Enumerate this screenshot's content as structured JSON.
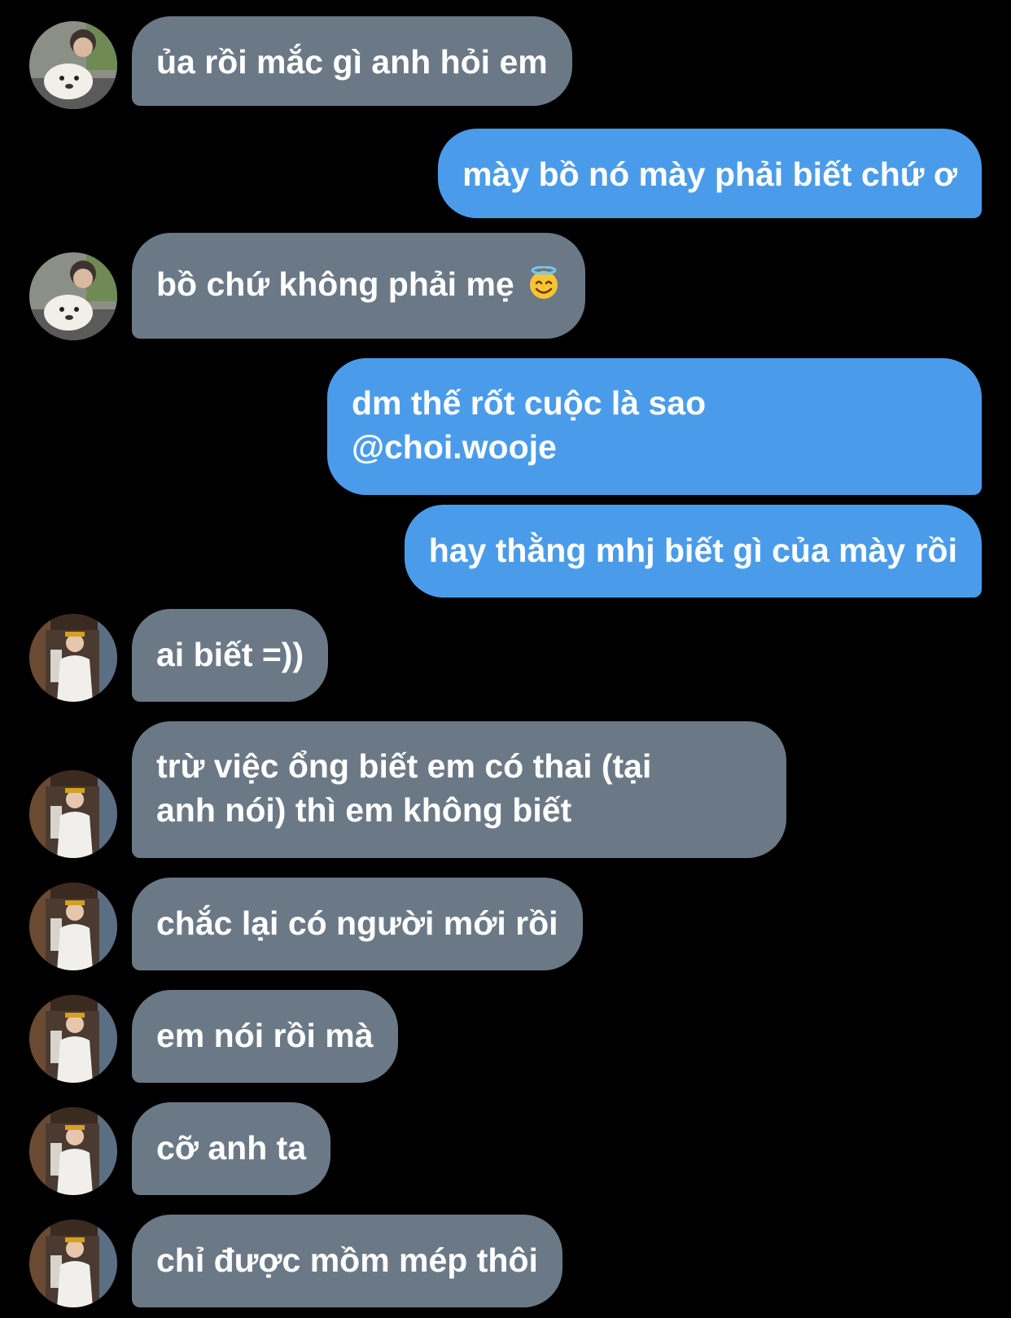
{
  "conversation": {
    "messages": [
      {
        "side": "in",
        "text": "ủa rồi mắc gì anh hỏi em",
        "avatar": "avatar-dog"
      },
      {
        "side": "out",
        "text": "mày bồ nó mày phải biết chứ ơ"
      },
      {
        "side": "in",
        "text": "bồ chứ không phải mẹ",
        "emoji": "smiling-face-with-halo",
        "avatar": "avatar-dog"
      },
      {
        "side": "out",
        "lines": [
          "dm thế rốt cuộc là sao",
          "@choi.wooje"
        ]
      },
      {
        "side": "out",
        "text": "hay thằng mhj biết gì của mày rồi"
      },
      {
        "side": "in",
        "text": "ai biết =))",
        "avatar": "avatar-room"
      },
      {
        "side": "in",
        "lines": [
          "trừ việc ổng biết em có thai (tại",
          "anh nói) thì em không biết"
        ],
        "avatar": "avatar-room"
      },
      {
        "side": "in",
        "text": "chắc lại có người mới rồi",
        "avatar": "avatar-room"
      },
      {
        "side": "in",
        "text": "em nói rồi mà",
        "avatar": "avatar-room"
      },
      {
        "side": "in",
        "text": "cỡ anh ta",
        "avatar": "avatar-room"
      },
      {
        "side": "in",
        "text": "chỉ được mồm mép thôi",
        "avatar": "avatar-room"
      }
    ]
  },
  "colors": {
    "background": "#000000",
    "incoming_bubble": "#6b7986",
    "outgoing_bubble": "#4a9cea",
    "text": "#ffffff"
  }
}
